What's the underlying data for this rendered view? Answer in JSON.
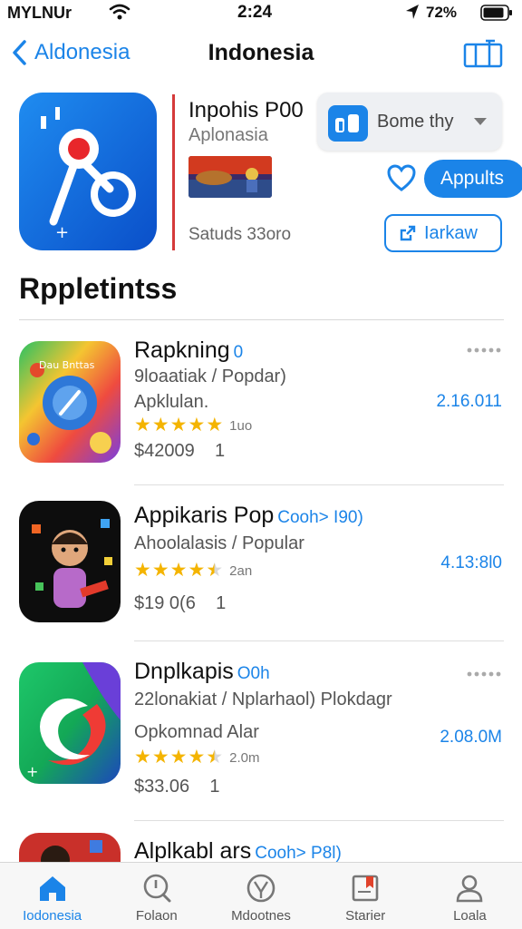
{
  "status_bar": {
    "carrier": "MYLNUr",
    "time": "2:24",
    "battery": "72%"
  },
  "nav": {
    "back_label": "Aldonesia",
    "title": "Indonesia",
    "action_icon": "share-grid-icon"
  },
  "hero": {
    "app_name": "Inpohis P00",
    "subtitle": "Aplonasia",
    "rating_text": "Satuds 33oro",
    "dropdown_label": "Bome thy",
    "primary_button": "Appults",
    "secondary_button": "Iarkaw",
    "accent_color": "#1b84e8"
  },
  "section": {
    "title": "Rppletintss"
  },
  "list": [
    {
      "title": "Rapkning",
      "tag": "0",
      "line1": "9loaatiak / Popdar)",
      "line2": "Apklulan.",
      "stars": 5,
      "rating_count": "1uo",
      "price": "$42009",
      "price_suffix": "1",
      "size": "2.16.011",
      "show_more": true
    },
    {
      "title": "Appikaris Pop",
      "tag": "Cooh> I90)",
      "line1": "Ahoolalasis / Popular",
      "line2": "",
      "stars": 4.5,
      "rating_count": "2an",
      "price": "$19 0(6",
      "price_suffix": "1",
      "size": "4.13:8l0",
      "show_more": false
    },
    {
      "title": "Dnplkapis",
      "tag": "O0h",
      "line1": "22lonakiat / Nplarhaol) Plokdagr",
      "line2": "Opkomnad Alar",
      "stars": 4.5,
      "rating_count": "2.0m",
      "price": "$33.06",
      "price_suffix": "1",
      "size": "2.08.0M",
      "show_more": true
    },
    {
      "title": "Alplkabl ars",
      "tag": "Cooh> P8l)",
      "line1": "",
      "line2": "",
      "stars": 0,
      "rating_count": "",
      "price": "",
      "price_suffix": "",
      "size": "",
      "show_more": false
    }
  ],
  "tabs": [
    {
      "label": "Iodonesia",
      "icon": "home-icon",
      "active": true
    },
    {
      "label": "Folaon",
      "icon": "search-icon",
      "active": false
    },
    {
      "label": "Mdootnes",
      "icon": "compass-icon",
      "active": false
    },
    {
      "label": "Starier",
      "icon": "bookmark-icon",
      "active": false
    },
    {
      "label": "Loala",
      "icon": "profile-icon",
      "active": false
    }
  ]
}
